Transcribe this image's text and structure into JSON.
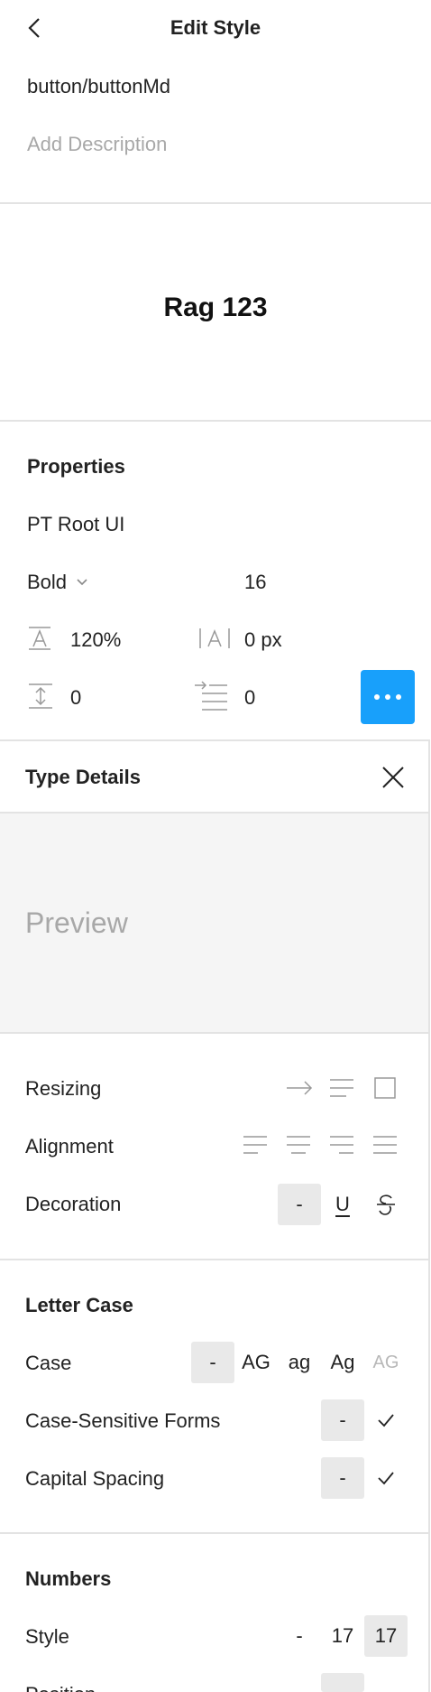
{
  "header": {
    "title": "Edit Style",
    "style_name": "button/buttonMd",
    "description_placeholder": "Add Description"
  },
  "preview_text": "Rag 123",
  "properties": {
    "heading": "Properties",
    "font_family": "PT Root UI",
    "font_weight": "Bold",
    "font_size": "16",
    "line_height": "120%",
    "letter_spacing": "0 px",
    "paragraph_spacing": "0",
    "paragraph_indent": "0"
  },
  "type_details": {
    "heading": "Type Details",
    "preview_placeholder": "Preview",
    "resizing_label": "Resizing",
    "alignment_label": "Alignment",
    "decoration_label": "Decoration",
    "decoration_none": "-",
    "decoration_underline": "U",
    "letter_case": {
      "heading": "Letter Case",
      "case_label": "Case",
      "case_options": [
        "-",
        "AG",
        "ag",
        "Ag",
        "AG"
      ],
      "case_sensitive_label": "Case-Sensitive Forms",
      "case_sensitive_none": "-",
      "capital_spacing_label": "Capital Spacing",
      "capital_spacing_none": "-"
    },
    "numbers": {
      "heading": "Numbers",
      "style_label": "Style",
      "style_options": [
        "-",
        "17",
        "17"
      ],
      "position_label": "Position"
    }
  }
}
